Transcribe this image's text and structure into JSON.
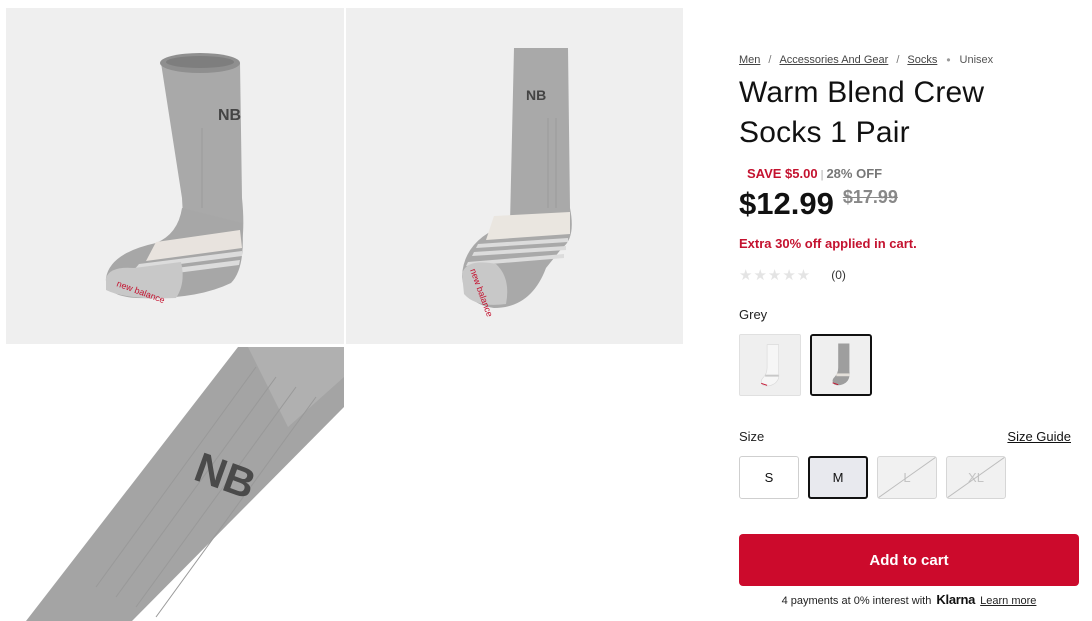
{
  "breadcrumb": {
    "items": [
      "Men",
      "Accessories And Gear",
      "Socks"
    ],
    "current": "Unisex"
  },
  "product": {
    "title": "Warm Blend Crew Socks 1 Pair",
    "save_text": "SAVE $5.00",
    "off_text": "28% OFF",
    "price": "$12.99",
    "original_price": "$17.99",
    "promo": "Extra 30% off applied in cart.",
    "rating_count": "(0)",
    "stars": "★★★★★"
  },
  "color": {
    "label": "Grey",
    "swatches": [
      "white",
      "grey"
    ],
    "selected": "grey"
  },
  "size": {
    "label": "Size",
    "guide_label": "Size Guide",
    "options": [
      {
        "label": "S",
        "state": "available"
      },
      {
        "label": "M",
        "state": "selected"
      },
      {
        "label": "L",
        "state": "unavailable"
      },
      {
        "label": "XL",
        "state": "unavailable"
      }
    ]
  },
  "cart": {
    "button_label": "Add to cart"
  },
  "klarna": {
    "text": "4 payments at 0% interest with",
    "logo": "Klarna",
    "learn_more": "Learn more"
  },
  "colors": {
    "accent_red": "#cc0a2c",
    "sale_red": "#c4122f",
    "sock_grey": "#a8a8a8",
    "tile_bg": "#efefef"
  }
}
